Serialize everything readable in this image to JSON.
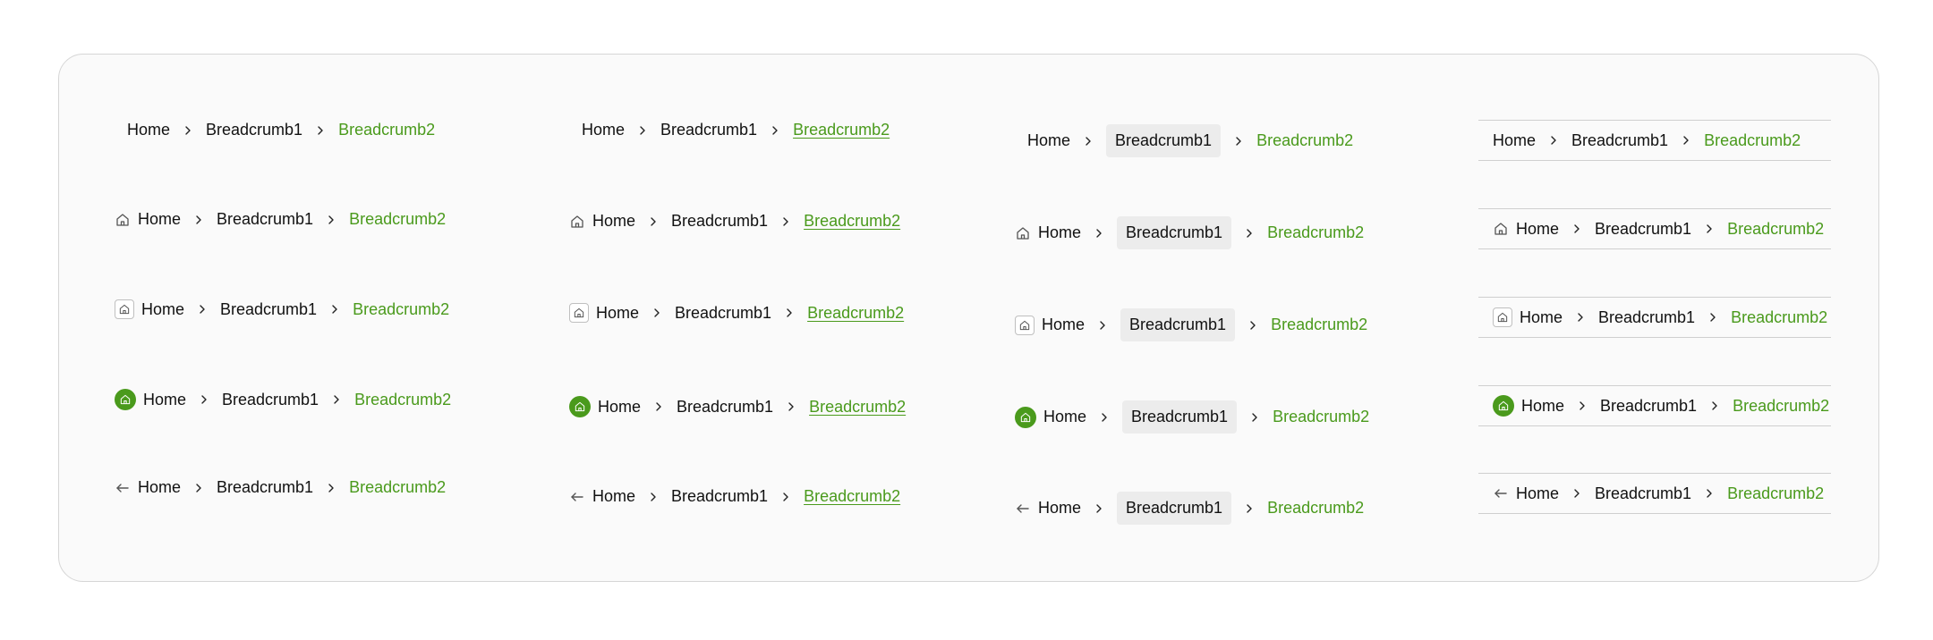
{
  "colors": {
    "accent": "#4a9a1c",
    "text": "#111111",
    "chip_bg": "#ececec",
    "border": "#d6d6d6"
  },
  "icons": {
    "home": "home-icon",
    "separator": "chevron-right-icon",
    "back": "arrow-left-icon"
  },
  "breadcrumb": {
    "home_label": "Home",
    "middle_label": "Breadcrumb1",
    "current_label": "Breadcrumb2"
  }
}
